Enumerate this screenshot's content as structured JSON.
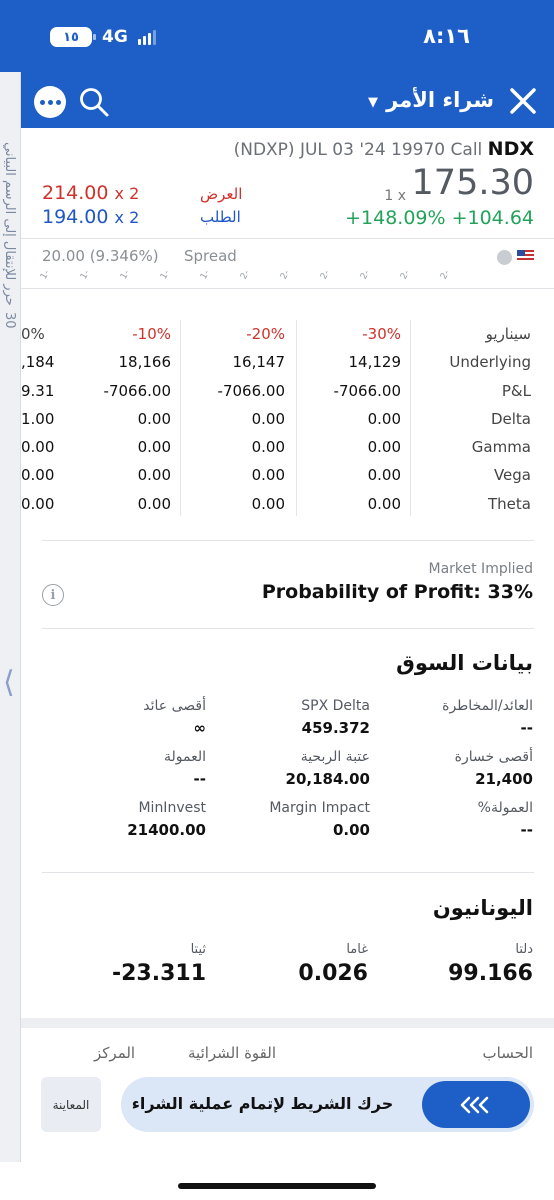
{
  "status": {
    "time": "٨:١٦",
    "network": "4G",
    "battery": "١٥"
  },
  "nav": {
    "title": "شراء الأمر"
  },
  "side_panel": {
    "text": "حرر للإنتقال إلى الرسم البياني",
    "tail": "30"
  },
  "quote": {
    "symbol": "NDX",
    "contract": "(NDXP) JUL 03 '24 19970 Call",
    "price": "175.30",
    "qty": "1 x",
    "change": "+148.09% +104.64",
    "ask_price": "214.00",
    "ask_size": "x 2",
    "ask_label": "العرض",
    "bid_price": "194.00",
    "bid_size": "x 2",
    "bid_label": "الطلب",
    "spread_value": "20.00 (9.346%)",
    "spread_label": "Spread"
  },
  "scenario": {
    "header_label": "سيناريو",
    "columns": [
      "0%",
      "-10%",
      "-20%",
      "-30%"
    ],
    "rows": [
      {
        "label": "Underlying",
        "values": [
          ",184",
          "18,166",
          "16,147",
          "14,129"
        ]
      },
      {
        "label": "P&L",
        "values": [
          "9.31",
          "-7066.00",
          "-7066.00",
          "-7066.00"
        ]
      },
      {
        "label": "Delta",
        "values": [
          "1.00",
          "0.00",
          "0.00",
          "0.00"
        ]
      },
      {
        "label": "Gamma",
        "values": [
          "0.00",
          "0.00",
          "0.00",
          "0.00"
        ]
      },
      {
        "label": "Vega",
        "values": [
          "0.00",
          "0.00",
          "0.00",
          "0.00"
        ]
      },
      {
        "label": "Theta",
        "values": [
          "0.00",
          "0.00",
          "0.00",
          "0.00"
        ]
      }
    ]
  },
  "probability": {
    "label": "Market Implied",
    "text": "Probability of Profit: 33%"
  },
  "market_data": {
    "title": "بيانات السوق",
    "items": [
      {
        "label": "العائد/المخاطرة",
        "value": "--"
      },
      {
        "label": "SPX Delta",
        "value": "459.372"
      },
      {
        "label": "أقصى عائد",
        "value": "∞"
      },
      {
        "label": "أقصى خسارة",
        "value": "21,400"
      },
      {
        "label": "عتبة الربحية",
        "value": "20,184.00"
      },
      {
        "label": "العمولة",
        "value": "--"
      },
      {
        "label": "%العمولة",
        "value": "--"
      },
      {
        "label": "Margin Impact",
        "value": "0.00"
      },
      {
        "label": "MinInvest",
        "value": "21400.00"
      }
    ]
  },
  "greeks": {
    "title": "اليونانيون",
    "items": [
      {
        "label": "دلتا",
        "value": "99.166"
      },
      {
        "label": "غاما",
        "value": "0.026"
      },
      {
        "label": "ثيتا",
        "value": "-23.311"
      }
    ]
  },
  "account": {
    "account_label": "الحساب",
    "buying_power_label": "القوة الشرائية",
    "position_label": "المركز"
  },
  "actions": {
    "preview": "المعاينة",
    "slide_label": "حرك الشريط لإتمام عملية الشراء"
  },
  "colors": {
    "brand": "#1d5fc6",
    "ask": "#d0322b",
    "bid": "#1f57c3",
    "gain": "#23a35a"
  }
}
